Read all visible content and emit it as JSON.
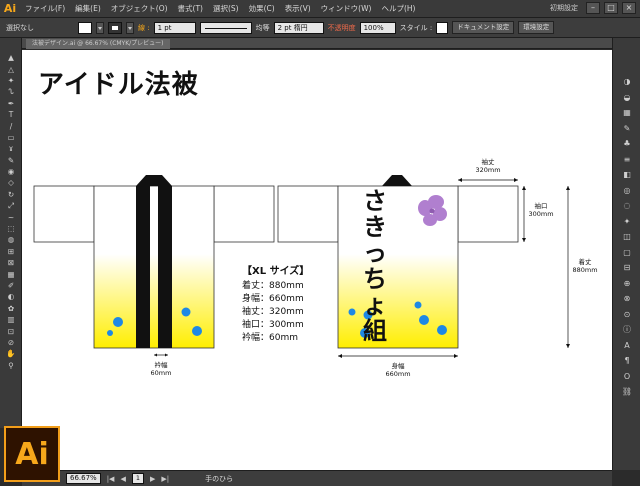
{
  "app": {
    "logo": "Ai",
    "badge_text": "Ai",
    "workspace": "初期設定",
    "menu": [
      "ファイル(F)",
      "編集(E)",
      "オブジェクト(O)",
      "書式(T)",
      "選択(S)",
      "効果(C)",
      "表示(V)",
      "ウィンドウ(W)",
      "ヘルプ(H)"
    ],
    "window_buttons": [
      "–",
      "□",
      "×"
    ]
  },
  "controlbar": {
    "selection_text": "選択なし",
    "stroke_label": "線 :",
    "stroke_weight": "1 pt",
    "profile_label": "均等",
    "brush_value": "2 pt 楕円",
    "opacity_label": "不透明度",
    "opacity_value": "100%",
    "style_label": "スタイル :",
    "doc_setup": "ドキュメント設定",
    "prefs": "環境設定"
  },
  "tabbar": {
    "doc_tab": "法被デザイン.ai @ 66.67% (CMYK/プレビュー)"
  },
  "toolbar": {
    "tools": [
      "selection-tool-icon",
      "direct-selection-tool-icon",
      "magic-wand-tool-icon",
      "lasso-tool-icon",
      "pen-tool-icon",
      "type-tool-icon",
      "line-tool-icon",
      "rectangle-tool-icon",
      "paintbrush-tool-icon",
      "pencil-tool-icon",
      "blob-brush-tool-icon",
      "eraser-tool-icon",
      "rotate-tool-icon",
      "scale-tool-icon",
      "warp-tool-icon",
      "free-transform-tool-icon",
      "shape-builder-tool-icon",
      "perspective-grid-tool-icon",
      "mesh-tool-icon",
      "gradient-tool-icon",
      "eyedropper-tool-icon",
      "blend-tool-icon",
      "symbol-sprayer-tool-icon",
      "column-graph-tool-icon",
      "artboard-tool-icon",
      "slice-tool-icon",
      "hand-tool-icon",
      "zoom-tool-icon"
    ],
    "glyphs": [
      "▲",
      "△",
      "✦",
      "ᔐ",
      "✒",
      "T",
      "/",
      "▭",
      "ɤ",
      "✎",
      "◉",
      "◇",
      "↻",
      "⤢",
      "~",
      "⬚",
      "◍",
      "⊞",
      "⊠",
      "▦",
      "✐",
      "◐",
      "✿",
      "▥",
      "⊡",
      "⊘",
      "✋",
      "⚲"
    ]
  },
  "canvas": {
    "title": "アイドル法被",
    "spec": {
      "heading": "【XL サイズ】",
      "lines": [
        "着丈：880mm",
        "身幅：660mm",
        "袖丈：320mm",
        "袖口：300mm",
        "衿幅：60mm"
      ]
    },
    "dims": {
      "collar": [
        "衿幅",
        "60mm"
      ],
      "body_width": [
        "身幅",
        "660mm"
      ],
      "sleeve_length": [
        "袖丈",
        "320mm"
      ],
      "cuff": [
        "袖口",
        "300mm"
      ],
      "length": [
        "着丈",
        "880mm"
      ]
    },
    "brand_text": "さきっちょ組",
    "colors": {
      "yellow": "#ffee00",
      "dot": "#1e88e5",
      "band": "#000000",
      "flower": "#b07fcf"
    }
  },
  "rightpanel": {
    "icons": [
      "color-panel-icon",
      "color-guide-icon",
      "swatches-icon",
      "brushes-icon",
      "symbols-icon",
      "stroke-icon",
      "gradient-panel-icon",
      "transparency-icon",
      "appearance-icon",
      "graphic-styles-icon",
      "layers-icon",
      "artboards-icon",
      "align-icon",
      "transform-icon",
      "pathfinder-icon",
      "navigator-icon",
      "info-icon",
      "character-icon",
      "paragraph-icon",
      "opentype-icon",
      "links-icon"
    ],
    "glyphs": [
      "◑",
      "◒",
      "▦",
      "✎",
      "♣",
      "≡",
      "◧",
      "◎",
      "◌",
      "✦",
      "◫",
      "▢",
      "⊟",
      "⊕",
      "⊗",
      "⊙",
      "ⓘ",
      "A",
      "¶",
      "O",
      "⛓"
    ]
  },
  "statusbar": {
    "zoom": "66.67%",
    "page": "1",
    "nav_first": "|◀",
    "nav_prev": "◀",
    "nav_next": "▶",
    "nav_last": "▶|",
    "tool_name": "手のひら"
  }
}
